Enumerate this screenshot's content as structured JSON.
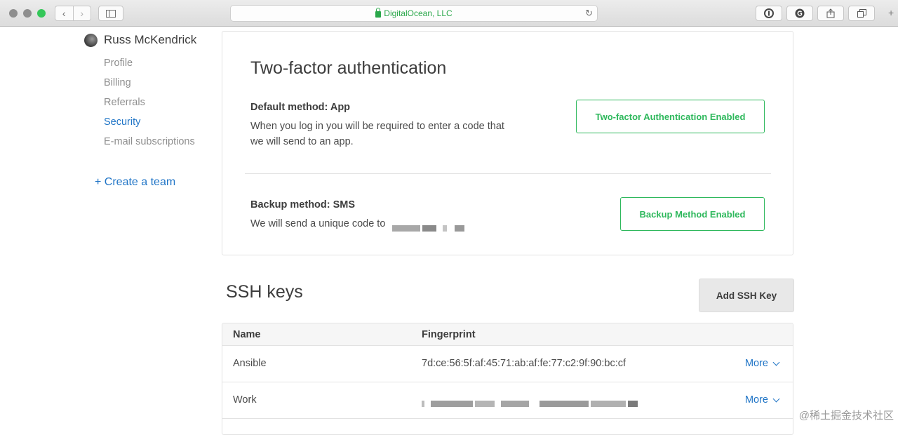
{
  "browser": {
    "url_text": "DigitalOcean, LLC",
    "reload_glyph": "↻",
    "back_glyph": "‹",
    "forward_glyph": "›"
  },
  "sidebar": {
    "user_name": "Russ McKendrick",
    "items": [
      {
        "label": "Profile",
        "active": false
      },
      {
        "label": "Billing",
        "active": false
      },
      {
        "label": "Referrals",
        "active": false
      },
      {
        "label": "Security",
        "active": true
      },
      {
        "label": "E-mail subscriptions",
        "active": false
      }
    ],
    "create_team": "+ Create a team"
  },
  "two_factor": {
    "title": "Two-factor authentication",
    "default": {
      "heading": "Default method: App",
      "line1": "When you log in you will be required to enter a code that",
      "line2": "we will send to an app.",
      "button": "Two-factor Authentication Enabled"
    },
    "backup": {
      "heading": "Backup method: SMS",
      "text": "We will send a unique code to",
      "button": "Backup Method Enabled"
    }
  },
  "ssh": {
    "title": "SSH keys",
    "add_button": "Add SSH Key",
    "columns": [
      "Name",
      "Fingerprint"
    ],
    "rows": [
      {
        "name": "Ansible",
        "fingerprint": "7d:ce:56:5f:af:45:71:ab:af:fe:77:c2:9f:90:bc:cf",
        "action": "More"
      },
      {
        "name": "Work",
        "fingerprint": "",
        "action": "More"
      }
    ]
  },
  "watermark": "@稀土掘金技术社区",
  "colors": {
    "accent_blue": "#1f74c6",
    "success_green": "#2eb85c",
    "text_dark": "#3d3d3d"
  }
}
